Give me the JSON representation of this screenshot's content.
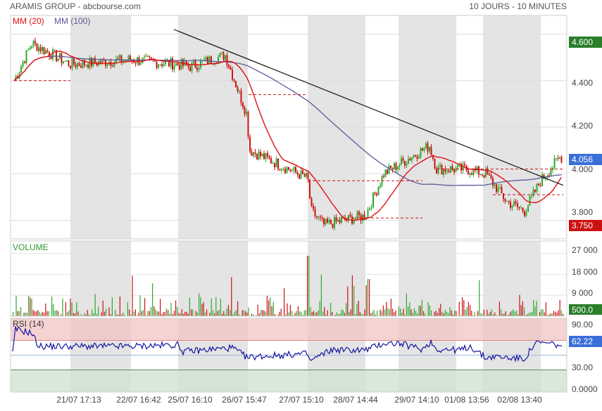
{
  "header": {
    "title": "ARAMIS GROUP - abcbourse.com",
    "period": "10 JOURS - 10 MINUTES"
  },
  "colors": {
    "band": "#e4e4e4",
    "up": "#2ea82e",
    "down": "#cc1111",
    "ma20": "#dd1111",
    "ma100": "#5a5a9a",
    "trend": "#111111",
    "rsi_over": "#f2c4c4",
    "rsi_under": "#cfe4cf",
    "label_green": "#2a7f2a",
    "label_blue": "#3b6fd8",
    "label_red": "#cc1111",
    "volume_label": "#2b9a2b",
    "grid": "#e9e9e9"
  },
  "price": {
    "legend": {
      "ma20": "MM (20)",
      "ma100": "MM (100)"
    },
    "ylim": [
      3.72,
      4.68
    ],
    "ticks": [
      "4.600",
      "4.400",
      "4.200",
      "4.000",
      "3.800"
    ],
    "tick_values": [
      4.6,
      4.4,
      4.2,
      4.0,
      3.8
    ],
    "high_label": "4.600",
    "last_label": "4.056",
    "low_label": "3.750",
    "high": 4.6,
    "last": 4.056,
    "low": 3.75
  },
  "volume": {
    "title": "VOLUME",
    "ylim": [
      0,
      30000
    ],
    "ticks": [
      "27 000",
      "18 000",
      "9 000"
    ],
    "tick_values": [
      27000,
      18000,
      9000
    ],
    "last_label": "500.0",
    "last": 500
  },
  "rsi": {
    "title": "RSI (14)",
    "ylim": [
      0,
      100
    ],
    "ticks": [
      "90.00",
      "30.00",
      "0.0000"
    ],
    "tick_values": [
      90,
      30,
      0
    ],
    "overbought": 70,
    "oversold": 30,
    "last_label": "62.22",
    "last": 62.22
  },
  "xaxis": {
    "labels": [
      "21/07 17:13",
      "22/07 16:42",
      "25/07 16:10",
      "26/07 15:47",
      "27/07 15:10",
      "28/07 14:44",
      "29/07 14:10",
      "01/08 13:56",
      "02/08 13:40"
    ]
  },
  "chart_data": {
    "type": "line",
    "title": "ARAMIS GROUP",
    "subtitle": "10 JOURS - 10 MINUTES",
    "x": [
      "21/07 17:13",
      "22/07 16:42",
      "25/07 16:10",
      "26/07 15:47",
      "27/07 15:10",
      "28/07 14:44",
      "29/07 14:10",
      "01/08 13:56",
      "02/08 13:40"
    ],
    "series": [
      {
        "name": "MM (20)",
        "values": [
          4.48,
          4.49,
          4.5,
          4.41,
          3.99,
          3.83,
          4.01,
          4.02,
          3.92
        ]
      },
      {
        "name": "MM (100)",
        "values": [
          4.47,
          4.48,
          4.49,
          4.49,
          4.17,
          3.93,
          3.94,
          3.98,
          3.98
        ]
      }
    ],
    "close_values": [
      4.46,
      4.49,
      4.5,
      4.08,
      3.96,
      3.8,
      4.04,
      4.02,
      3.88
    ],
    "last": 4.056,
    "range_high": 4.6,
    "range_low": 3.75,
    "ylim": [
      3.72,
      4.68
    ],
    "grid": true
  }
}
